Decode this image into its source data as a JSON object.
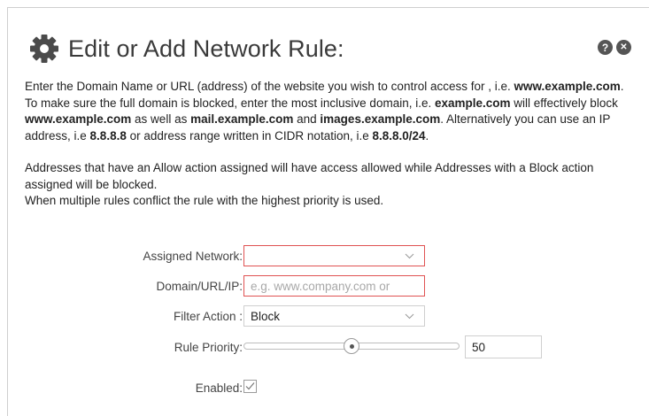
{
  "dialog": {
    "title": "Edit or Add Network Rule:",
    "header_icons": [
      "gear-icon",
      "help-icon",
      "close-icon"
    ],
    "help_glyph": "?",
    "close_glyph": "✕"
  },
  "description": {
    "p1": {
      "t1": "Enter the Domain Name or URL (address) of the website you wish to control access for , i.e. ",
      "b1": "www.example.com",
      "t2": ". To make sure the full domain is blocked, enter the most inclusive domain, i.e. ",
      "b2": "example.com",
      "t3": " will effectively block ",
      "b3": "www.example.com",
      "t4": " as well as ",
      "b4": "mail.example.com",
      "t5": " and ",
      "b5": "images.example.com",
      "t6": ". Alternatively you can use an IP address, i.e ",
      "b6": "8.8.8.8",
      "t7": " or address range written in CIDR notation, i.e ",
      "b7": "8.8.8.0/24",
      "t8": "."
    },
    "p2_line1": "Addresses that have an Allow action assigned will have access allowed while Addresses with a Block action assigned will be blocked.",
    "p2_line2": "When multiple rules conflict the rule with the highest priority is used."
  },
  "form": {
    "assigned_network": {
      "label": "Assigned Network:",
      "value": ""
    },
    "domain": {
      "label": "Domain/URL/IP:",
      "value": "",
      "placeholder": "e.g. www.company.com or"
    },
    "filter_action": {
      "label": "Filter Action :",
      "value": "Block"
    },
    "rule_priority": {
      "label": "Rule Priority:",
      "value": "50",
      "fraction": 0.5
    },
    "enabled": {
      "label": "Enabled:",
      "checked": true
    }
  },
  "colors": {
    "invalid_border": "#e05252",
    "icon_dark": "#555555"
  }
}
